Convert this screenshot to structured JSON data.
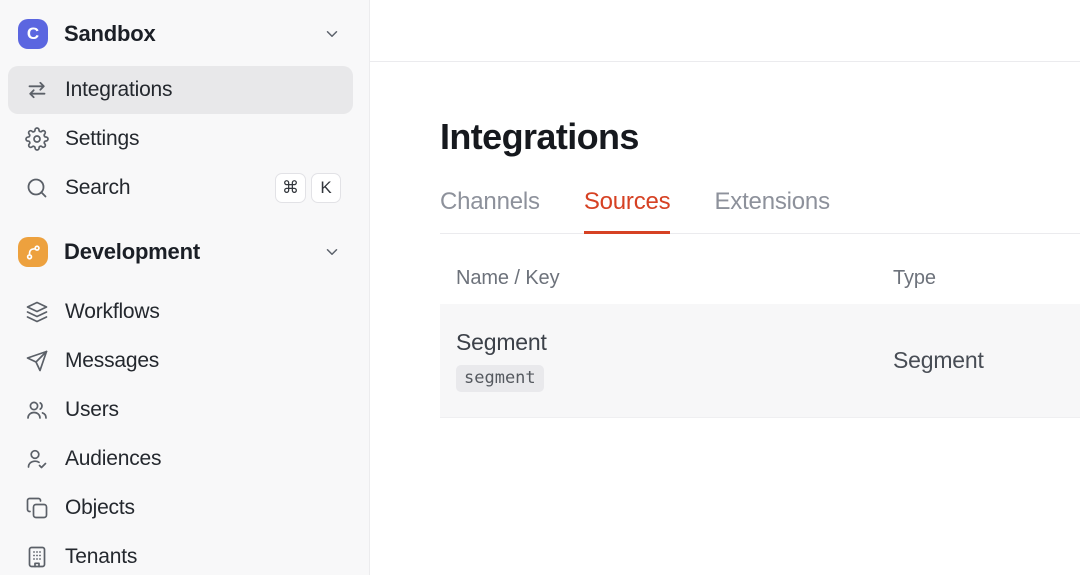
{
  "colors": {
    "sidebar-bg": "#f8f8f9",
    "sidebar-border": "#ececee",
    "active-item-bg": "#e8e8ea",
    "brand": "#5b66e0",
    "dev-orange": "#eda13e",
    "accent": "#d64123",
    "tab-inactive": "#8d919b",
    "row-bg": "#f7f7f8",
    "badge-bg": "#e9e9ec"
  },
  "sidebar": {
    "workspace": {
      "label": "Sandbox",
      "logo_letter": "C",
      "chevron_icon": "chevron-down-icon"
    },
    "nav": [
      {
        "label": "Integrations",
        "icon": "swap-arrows-icon",
        "active": true
      },
      {
        "label": "Settings",
        "icon": "gear-icon"
      },
      {
        "label": "Search",
        "icon": "search-icon",
        "shortcut": [
          "⌘",
          "K"
        ]
      }
    ],
    "section": {
      "label": "Development",
      "icon": "branch-icon",
      "chevron_icon": "chevron-down-icon"
    },
    "dev_nav": [
      {
        "label": "Workflows",
        "icon": "layers-icon"
      },
      {
        "label": "Messages",
        "icon": "paper-plane-icon"
      },
      {
        "label": "Users",
        "icon": "users-icon"
      },
      {
        "label": "Audiences",
        "icon": "user-check-icon"
      },
      {
        "label": "Objects",
        "icon": "copy-icon"
      },
      {
        "label": "Tenants",
        "icon": "building-icon"
      }
    ]
  },
  "main": {
    "title": "Integrations",
    "tabs": [
      {
        "label": "Channels",
        "active": false
      },
      {
        "label": "Sources",
        "active": true
      },
      {
        "label": "Extensions",
        "active": false
      }
    ],
    "table": {
      "columns": [
        "Name / Key",
        "Type"
      ],
      "rows": [
        {
          "name": "Segment",
          "key": "segment",
          "type": "Segment"
        }
      ]
    }
  }
}
